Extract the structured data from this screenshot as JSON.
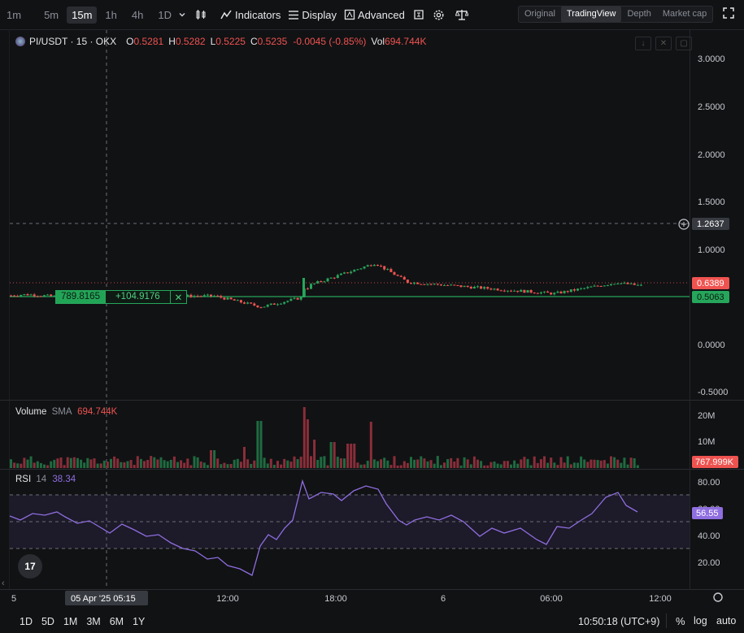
{
  "toolbar": {
    "timeframes": [
      "1m",
      "5m",
      "15m",
      "1h",
      "4h",
      "1D"
    ],
    "active_timeframe": "15m",
    "indicators_label": "Indicators",
    "display_label": "Display",
    "advanced_label": "Advanced"
  },
  "view_tabs": [
    "Original",
    "TradingView",
    "Depth",
    "Market cap"
  ],
  "active_view": "TradingView",
  "legend": {
    "symbol": "PI/USDT · 15 · OKX",
    "o_label": "O",
    "open": "0.5281",
    "h_label": "H",
    "high": "0.5282",
    "l_label": "L",
    "low": "0.5225",
    "c_label": "C",
    "close": "0.5235",
    "change": "-0.0045 (-0.85%)",
    "vol_label": "Vol",
    "vol": "694.744K"
  },
  "price_axis": [
    "3.0000",
    "2.5000",
    "2.0000",
    "1.5000",
    "1.0000",
    "0.5000",
    "0.0000",
    "-0.5000"
  ],
  "price_tags": {
    "crosshair": "1.2637",
    "last": "0.6389",
    "position": "0.5063"
  },
  "position": {
    "qty": "789.8165",
    "pnl": "+104.9176",
    "close": "✕"
  },
  "volume_pane": {
    "label": "Volume",
    "ma": "SMA",
    "value": "694.744K",
    "axis": [
      "20M",
      "10M"
    ],
    "tag": "767.999K"
  },
  "rsi_pane": {
    "label": "RSI",
    "period": "14",
    "value": "38.34",
    "axis": [
      "80.00",
      "60.00",
      "40.00",
      "20.00"
    ],
    "tag": "56.55"
  },
  "time_axis": [
    "5",
    "12:00",
    "18:00",
    "6",
    "06:00",
    "12:00"
  ],
  "crosshair_time": "05 Apr '25   05:15",
  "bottom_ranges": [
    "1D",
    "5D",
    "1M",
    "3M",
    "6M",
    "1Y"
  ],
  "clock": "10:50:18 (UTC+9)",
  "scale_pct": "%",
  "scale_log": "log",
  "scale_auto": "auto",
  "logo": "17",
  "colors": {
    "up": "#26a65b",
    "down": "#ef5350",
    "rsi": "#8f6ee0",
    "bg": "#111214"
  }
}
